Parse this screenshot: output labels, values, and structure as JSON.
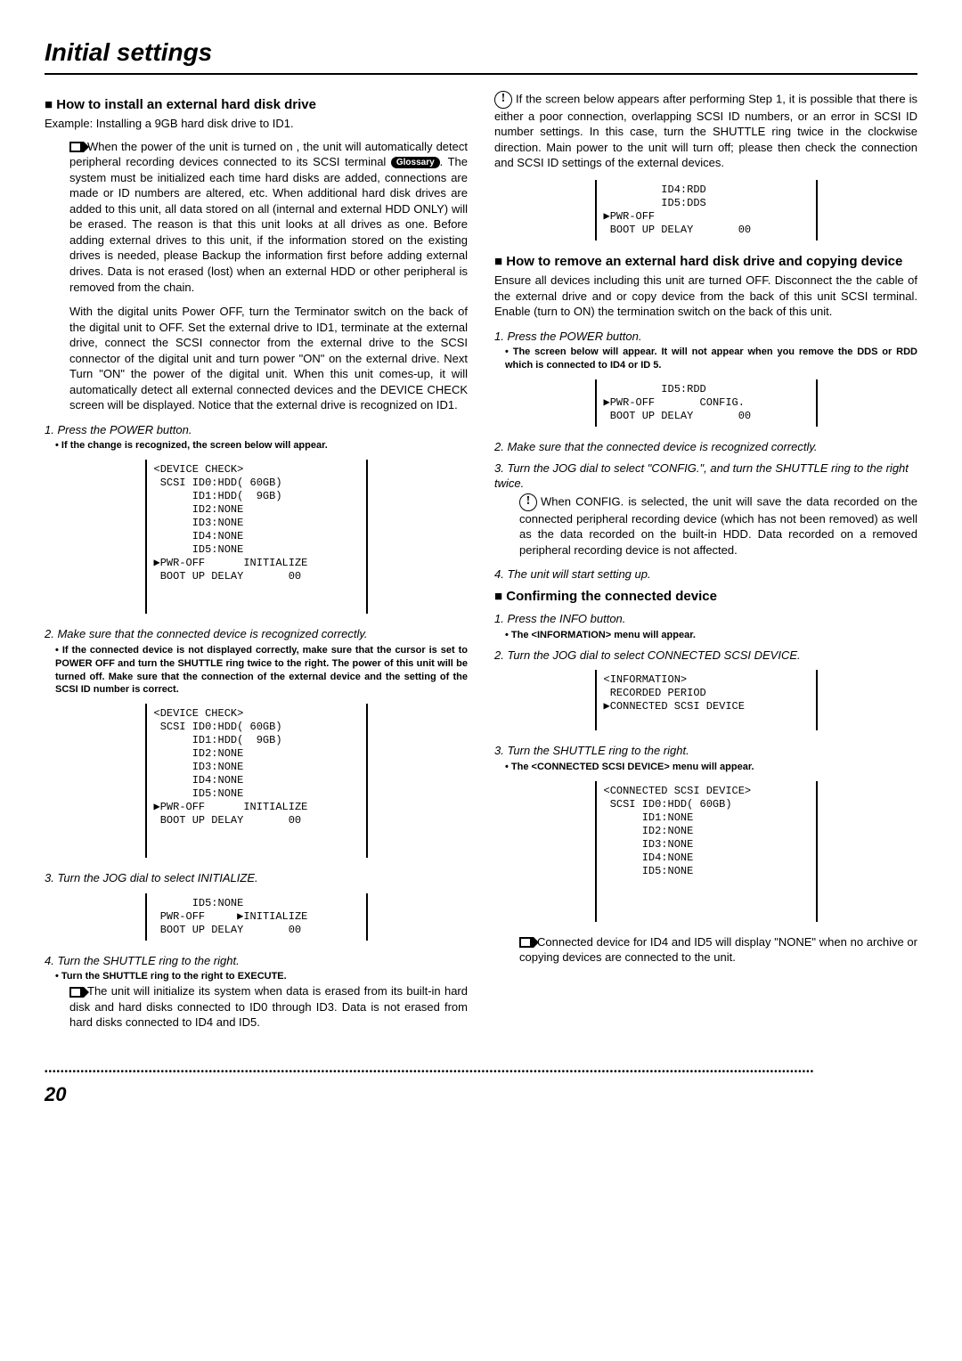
{
  "title": "Initial settings",
  "pageNumber": "20",
  "glossary": "Glossary",
  "left": {
    "h_install": "How to install an external hard disk drive",
    "example": "Example: Installing a 9GB hard disk drive to ID1.",
    "p1a": "When the power of the unit is turned on , the unit will automatically detect peripheral recording devices connected to its SCSI terminal ",
    "p1b": ". The system must be initialized each time hard disks are added, connections are made or ID numbers are altered, etc. When additional hard disk drives are added to this unit, all data stored on all (internal and external HDD ONLY) will be erased.  The reason is that this unit looks at all drives as one.  Before adding external drives to this unit, if the information stored on the existing drives is needed, please Backup the information first before adding external drives. Data is not erased (lost) when an external HDD or other peripheral is removed from the chain.",
    "p2": "With the digital units Power OFF, turn the Terminator switch on the back of the digital unit to OFF. Set the external drive to ID1, terminate at the external drive, connect the SCSI connector from the external drive to the SCSI connector of the digital unit and turn power \"ON\" on the external drive.  Next Turn \"ON\" the power of the digital unit.  When this unit comes-up, it will automatically detect all external connected devices and the DEVICE CHECK screen will be displayed. Notice that the external drive is recognized on ID1.",
    "s1": "1. Press the POWER button.",
    "s1b": "If the change is recognized, the screen below will appear.",
    "screen1": "<DEVICE CHECK>\n SCSI ID0:HDD( 60GB)\n      ID1:HDD(  9GB)\n      ID2:NONE\n      ID3:NONE\n      ID4:NONE\n      ID5:NONE\n▶PWR-OFF      INITIALIZE\n BOOT UP DELAY       00\n \n ",
    "s2": "2. Make sure that the connected device is recognized correctly.",
    "s2b": "If the connected device is not displayed correctly, make sure that the cursor is set to POWER OFF and turn the SHUTTLE ring twice to the right.  The power of this unit will be turned off.  Make sure that the connection of the external device and the setting of the SCSI ID number is correct.",
    "screen2": "<DEVICE CHECK>\n SCSI ID0:HDD( 60GB)\n      ID1:HDD(  9GB)\n      ID2:NONE\n      ID3:NONE\n      ID4:NONE\n      ID5:NONE\n▶PWR-OFF      INITIALIZE\n BOOT UP DELAY       00\n \n ",
    "s3": "3. Turn the JOG dial to select INITIALIZE.",
    "screen3": "      ID5:NONE\n PWR-OFF     ▶INITIALIZE\n BOOT UP DELAY       00",
    "s4": "4. Turn the SHUTTLE ring to the right.",
    "s4b": "Turn the SHUTTLE ring to the right to EXECUTE.",
    "p3": "The unit will initialize its system when data is erased from its built-in hard disk and hard disks connected to ID0 through ID3. Data is not erased from hard disks connected to ID4 and ID5."
  },
  "right": {
    "p1": "If the screen below appears after performing Step 1, it is possible that there is either a poor connection, overlapping SCSI ID numbers, or an error in SCSI ID number settings. In this case, turn the SHUTTLE ring twice in the clockwise direction. Main power to the unit will turn off; please then check the connection and SCSI ID settings of the external devices.",
    "screen1": "         ID4:RDD\n         ID5:DDS\n▶PWR-OFF\n BOOT UP DELAY       00",
    "h_remove": "How to remove an external hard disk drive and copying device",
    "p2": "Ensure all devices including this unit are turned OFF.  Disconnect the the cable of the external drive and or copy device from the back of this unit SCSI terminal.  Enable (turn to ON) the termination switch on the back of this unit.",
    "s1": "1. Press the POWER button.",
    "s1b": "The screen below will appear.  It will not appear when you remove the DDS or RDD which is connected to ID4 or ID 5.",
    "screen2": "         ID5:RDD\n▶PWR-OFF       CONFIG.\n BOOT UP DELAY       00",
    "s2": "2. Make sure that the connected device is recognized correctly.",
    "s3": "3. Turn the JOG dial to select \"CONFIG.\", and turn the SHUTTLE ring to the right twice.",
    "p3": "When CONFIG. is selected, the unit will save the data recorded on the connected peripheral recording device (which has not been removed) as well as the data recorded on the built-in HDD. Data recorded on a removed peripheral recording device is not affected.",
    "s4": "4. The unit will start setting up.",
    "h_confirm": "Confirming the connected device",
    "c1": "1. Press the INFO button.",
    "c1b": "The <INFORMATION> menu will appear.",
    "c2": "2. Turn the JOG dial to select CONNECTED SCSI DEVICE.",
    "screen3": "<INFORMATION>\n RECORDED PERIOD\n▶CONNECTED SCSI DEVICE\n ",
    "c3": "3. Turn the SHUTTLE ring to the right.",
    "c3b": "The <CONNECTED SCSI DEVICE> menu will appear.",
    "screen4": "<CONNECTED SCSI DEVICE>\n SCSI ID0:HDD( 60GB)\n      ID1:NONE\n      ID2:NONE\n      ID3:NONE\n      ID4:NONE\n      ID5:NONE\n \n \n ",
    "p4": "Connected device for ID4 and ID5 will display \"NONE\" when no archive or copying devices are connected to the unit."
  }
}
